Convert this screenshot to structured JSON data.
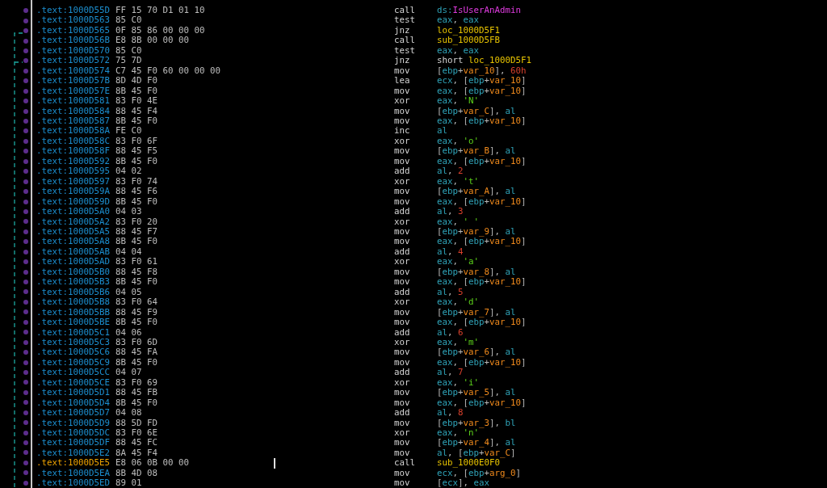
{
  "listing": {
    "rows": [
      {
        "address": ".text:1000D55D",
        "bytes": "FF 15 70 D1 01 10",
        "mnemonic": "call",
        "operands": [
          {
            "kind": "reg",
            "text": "ds:"
          },
          {
            "kind": "import",
            "text": "IsUserAnAdmin"
          }
        ],
        "current": false
      },
      {
        "address": ".text:1000D563",
        "bytes": "85 C0",
        "mnemonic": "test",
        "operands": [
          {
            "kind": "reg",
            "text": "eax"
          },
          {
            "kind": "p",
            "text": ", "
          },
          {
            "kind": "reg",
            "text": "eax"
          }
        ],
        "current": false
      },
      {
        "address": ".text:1000D565",
        "bytes": "0F 85 86 00 00 00",
        "mnemonic": "jnz",
        "operands": [
          {
            "kind": "name",
            "text": "loc_1000D5F1"
          }
        ],
        "current": false
      },
      {
        "address": ".text:1000D56B",
        "bytes": "E8 8B 00 00 00",
        "mnemonic": "call",
        "operands": [
          {
            "kind": "name",
            "text": "sub_1000D5FB"
          }
        ],
        "current": false
      },
      {
        "address": ".text:1000D570",
        "bytes": "85 C0",
        "mnemonic": "test",
        "operands": [
          {
            "kind": "reg",
            "text": "eax"
          },
          {
            "kind": "p",
            "text": ", "
          },
          {
            "kind": "reg",
            "text": "eax"
          }
        ],
        "current": false
      },
      {
        "address": ".text:1000D572",
        "bytes": "75 7D",
        "mnemonic": "jnz",
        "operands": [
          {
            "kind": "kw",
            "text": "short "
          },
          {
            "kind": "name",
            "text": "loc_1000D5F1"
          }
        ],
        "current": false
      },
      {
        "address": ".text:1000D574",
        "bytes": "C7 45 F0 60 00 00 00",
        "mnemonic": "mov",
        "operands": [
          {
            "kind": "p",
            "text": "["
          },
          {
            "kind": "reg",
            "text": "ebp"
          },
          {
            "kind": "p",
            "text": "+"
          },
          {
            "kind": "var",
            "text": "var_10"
          },
          {
            "kind": "p",
            "text": "], "
          },
          {
            "kind": "num",
            "text": "60h"
          }
        ],
        "current": false
      },
      {
        "address": ".text:1000D57B",
        "bytes": "8D 4D F0",
        "mnemonic": "lea",
        "operands": [
          {
            "kind": "reg",
            "text": "ecx"
          },
          {
            "kind": "p",
            "text": ", ["
          },
          {
            "kind": "reg",
            "text": "ebp"
          },
          {
            "kind": "p",
            "text": "+"
          },
          {
            "kind": "var",
            "text": "var_10"
          },
          {
            "kind": "p",
            "text": "]"
          }
        ],
        "current": false
      },
      {
        "address": ".text:1000D57E",
        "bytes": "8B 45 F0",
        "mnemonic": "mov",
        "operands": [
          {
            "kind": "reg",
            "text": "eax"
          },
          {
            "kind": "p",
            "text": ", ["
          },
          {
            "kind": "reg",
            "text": "ebp"
          },
          {
            "kind": "p",
            "text": "+"
          },
          {
            "kind": "var",
            "text": "var_10"
          },
          {
            "kind": "p",
            "text": "]"
          }
        ],
        "current": false
      },
      {
        "address": ".text:1000D581",
        "bytes": "83 F0 4E",
        "mnemonic": "xor",
        "operands": [
          {
            "kind": "reg",
            "text": "eax"
          },
          {
            "kind": "p",
            "text": ", "
          },
          {
            "kind": "str",
            "text": "'N'"
          }
        ],
        "current": false
      },
      {
        "address": ".text:1000D584",
        "bytes": "88 45 F4",
        "mnemonic": "mov",
        "operands": [
          {
            "kind": "p",
            "text": "["
          },
          {
            "kind": "reg",
            "text": "ebp"
          },
          {
            "kind": "p",
            "text": "+"
          },
          {
            "kind": "var",
            "text": "var_C"
          },
          {
            "kind": "p",
            "text": "], "
          },
          {
            "kind": "reg",
            "text": "al"
          }
        ],
        "current": false
      },
      {
        "address": ".text:1000D587",
        "bytes": "8B 45 F0",
        "mnemonic": "mov",
        "operands": [
          {
            "kind": "reg",
            "text": "eax"
          },
          {
            "kind": "p",
            "text": ", ["
          },
          {
            "kind": "reg",
            "text": "ebp"
          },
          {
            "kind": "p",
            "text": "+"
          },
          {
            "kind": "var",
            "text": "var_10"
          },
          {
            "kind": "p",
            "text": "]"
          }
        ],
        "current": false
      },
      {
        "address": ".text:1000D58A",
        "bytes": "FE C0",
        "mnemonic": "inc",
        "operands": [
          {
            "kind": "reg",
            "text": "al"
          }
        ],
        "current": false
      },
      {
        "address": ".text:1000D58C",
        "bytes": "83 F0 6F",
        "mnemonic": "xor",
        "operands": [
          {
            "kind": "reg",
            "text": "eax"
          },
          {
            "kind": "p",
            "text": ", "
          },
          {
            "kind": "str",
            "text": "'o'"
          }
        ],
        "current": false
      },
      {
        "address": ".text:1000D58F",
        "bytes": "88 45 F5",
        "mnemonic": "mov",
        "operands": [
          {
            "kind": "p",
            "text": "["
          },
          {
            "kind": "reg",
            "text": "ebp"
          },
          {
            "kind": "p",
            "text": "+"
          },
          {
            "kind": "var",
            "text": "var_B"
          },
          {
            "kind": "p",
            "text": "], "
          },
          {
            "kind": "reg",
            "text": "al"
          }
        ],
        "current": false
      },
      {
        "address": ".text:1000D592",
        "bytes": "8B 45 F0",
        "mnemonic": "mov",
        "operands": [
          {
            "kind": "reg",
            "text": "eax"
          },
          {
            "kind": "p",
            "text": ", ["
          },
          {
            "kind": "reg",
            "text": "ebp"
          },
          {
            "kind": "p",
            "text": "+"
          },
          {
            "kind": "var",
            "text": "var_10"
          },
          {
            "kind": "p",
            "text": "]"
          }
        ],
        "current": false
      },
      {
        "address": ".text:1000D595",
        "bytes": "04 02",
        "mnemonic": "add",
        "operands": [
          {
            "kind": "reg",
            "text": "al"
          },
          {
            "kind": "p",
            "text": ", "
          },
          {
            "kind": "num",
            "text": "2"
          }
        ],
        "current": false
      },
      {
        "address": ".text:1000D597",
        "bytes": "83 F0 74",
        "mnemonic": "xor",
        "operands": [
          {
            "kind": "reg",
            "text": "eax"
          },
          {
            "kind": "p",
            "text": ", "
          },
          {
            "kind": "str",
            "text": "'t'"
          }
        ],
        "current": false
      },
      {
        "address": ".text:1000D59A",
        "bytes": "88 45 F6",
        "mnemonic": "mov",
        "operands": [
          {
            "kind": "p",
            "text": "["
          },
          {
            "kind": "reg",
            "text": "ebp"
          },
          {
            "kind": "p",
            "text": "+"
          },
          {
            "kind": "var",
            "text": "var_A"
          },
          {
            "kind": "p",
            "text": "], "
          },
          {
            "kind": "reg",
            "text": "al"
          }
        ],
        "current": false
      },
      {
        "address": ".text:1000D59D",
        "bytes": "8B 45 F0",
        "mnemonic": "mov",
        "operands": [
          {
            "kind": "reg",
            "text": "eax"
          },
          {
            "kind": "p",
            "text": ", ["
          },
          {
            "kind": "reg",
            "text": "ebp"
          },
          {
            "kind": "p",
            "text": "+"
          },
          {
            "kind": "var",
            "text": "var_10"
          },
          {
            "kind": "p",
            "text": "]"
          }
        ],
        "current": false
      },
      {
        "address": ".text:1000D5A0",
        "bytes": "04 03",
        "mnemonic": "add",
        "operands": [
          {
            "kind": "reg",
            "text": "al"
          },
          {
            "kind": "p",
            "text": ", "
          },
          {
            "kind": "num",
            "text": "3"
          }
        ],
        "current": false
      },
      {
        "address": ".text:1000D5A2",
        "bytes": "83 F0 20",
        "mnemonic": "xor",
        "operands": [
          {
            "kind": "reg",
            "text": "eax"
          },
          {
            "kind": "p",
            "text": ", "
          },
          {
            "kind": "str",
            "text": "' '"
          }
        ],
        "current": false
      },
      {
        "address": ".text:1000D5A5",
        "bytes": "88 45 F7",
        "mnemonic": "mov",
        "operands": [
          {
            "kind": "p",
            "text": "["
          },
          {
            "kind": "reg",
            "text": "ebp"
          },
          {
            "kind": "p",
            "text": "+"
          },
          {
            "kind": "var",
            "text": "var_9"
          },
          {
            "kind": "p",
            "text": "], "
          },
          {
            "kind": "reg",
            "text": "al"
          }
        ],
        "current": false
      },
      {
        "address": ".text:1000D5A8",
        "bytes": "8B 45 F0",
        "mnemonic": "mov",
        "operands": [
          {
            "kind": "reg",
            "text": "eax"
          },
          {
            "kind": "p",
            "text": ", ["
          },
          {
            "kind": "reg",
            "text": "ebp"
          },
          {
            "kind": "p",
            "text": "+"
          },
          {
            "kind": "var",
            "text": "var_10"
          },
          {
            "kind": "p",
            "text": "]"
          }
        ],
        "current": false
      },
      {
        "address": ".text:1000D5AB",
        "bytes": "04 04",
        "mnemonic": "add",
        "operands": [
          {
            "kind": "reg",
            "text": "al"
          },
          {
            "kind": "p",
            "text": ", "
          },
          {
            "kind": "num",
            "text": "4"
          }
        ],
        "current": false
      },
      {
        "address": ".text:1000D5AD",
        "bytes": "83 F0 61",
        "mnemonic": "xor",
        "operands": [
          {
            "kind": "reg",
            "text": "eax"
          },
          {
            "kind": "p",
            "text": ", "
          },
          {
            "kind": "str",
            "text": "'a'"
          }
        ],
        "current": false
      },
      {
        "address": ".text:1000D5B0",
        "bytes": "88 45 F8",
        "mnemonic": "mov",
        "operands": [
          {
            "kind": "p",
            "text": "["
          },
          {
            "kind": "reg",
            "text": "ebp"
          },
          {
            "kind": "p",
            "text": "+"
          },
          {
            "kind": "var",
            "text": "var_8"
          },
          {
            "kind": "p",
            "text": "], "
          },
          {
            "kind": "reg",
            "text": "al"
          }
        ],
        "current": false
      },
      {
        "address": ".text:1000D5B3",
        "bytes": "8B 45 F0",
        "mnemonic": "mov",
        "operands": [
          {
            "kind": "reg",
            "text": "eax"
          },
          {
            "kind": "p",
            "text": ", ["
          },
          {
            "kind": "reg",
            "text": "ebp"
          },
          {
            "kind": "p",
            "text": "+"
          },
          {
            "kind": "var",
            "text": "var_10"
          },
          {
            "kind": "p",
            "text": "]"
          }
        ],
        "current": false
      },
      {
        "address": ".text:1000D5B6",
        "bytes": "04 05",
        "mnemonic": "add",
        "operands": [
          {
            "kind": "reg",
            "text": "al"
          },
          {
            "kind": "p",
            "text": ", "
          },
          {
            "kind": "num",
            "text": "5"
          }
        ],
        "current": false
      },
      {
        "address": ".text:1000D5B8",
        "bytes": "83 F0 64",
        "mnemonic": "xor",
        "operands": [
          {
            "kind": "reg",
            "text": "eax"
          },
          {
            "kind": "p",
            "text": ", "
          },
          {
            "kind": "str",
            "text": "'d'"
          }
        ],
        "current": false
      },
      {
        "address": ".text:1000D5BB",
        "bytes": "88 45 F9",
        "mnemonic": "mov",
        "operands": [
          {
            "kind": "p",
            "text": "["
          },
          {
            "kind": "reg",
            "text": "ebp"
          },
          {
            "kind": "p",
            "text": "+"
          },
          {
            "kind": "var",
            "text": "var_7"
          },
          {
            "kind": "p",
            "text": "], "
          },
          {
            "kind": "reg",
            "text": "al"
          }
        ],
        "current": false
      },
      {
        "address": ".text:1000D5BE",
        "bytes": "8B 45 F0",
        "mnemonic": "mov",
        "operands": [
          {
            "kind": "reg",
            "text": "eax"
          },
          {
            "kind": "p",
            "text": ", ["
          },
          {
            "kind": "reg",
            "text": "ebp"
          },
          {
            "kind": "p",
            "text": "+"
          },
          {
            "kind": "var",
            "text": "var_10"
          },
          {
            "kind": "p",
            "text": "]"
          }
        ],
        "current": false
      },
      {
        "address": ".text:1000D5C1",
        "bytes": "04 06",
        "mnemonic": "add",
        "operands": [
          {
            "kind": "reg",
            "text": "al"
          },
          {
            "kind": "p",
            "text": ", "
          },
          {
            "kind": "num",
            "text": "6"
          }
        ],
        "current": false
      },
      {
        "address": ".text:1000D5C3",
        "bytes": "83 F0 6D",
        "mnemonic": "xor",
        "operands": [
          {
            "kind": "reg",
            "text": "eax"
          },
          {
            "kind": "p",
            "text": ", "
          },
          {
            "kind": "str",
            "text": "'m'"
          }
        ],
        "current": false
      },
      {
        "address": ".text:1000D5C6",
        "bytes": "88 45 FA",
        "mnemonic": "mov",
        "operands": [
          {
            "kind": "p",
            "text": "["
          },
          {
            "kind": "reg",
            "text": "ebp"
          },
          {
            "kind": "p",
            "text": "+"
          },
          {
            "kind": "var",
            "text": "var_6"
          },
          {
            "kind": "p",
            "text": "], "
          },
          {
            "kind": "reg",
            "text": "al"
          }
        ],
        "current": false
      },
      {
        "address": ".text:1000D5C9",
        "bytes": "8B 45 F0",
        "mnemonic": "mov",
        "operands": [
          {
            "kind": "reg",
            "text": "eax"
          },
          {
            "kind": "p",
            "text": ", ["
          },
          {
            "kind": "reg",
            "text": "ebp"
          },
          {
            "kind": "p",
            "text": "+"
          },
          {
            "kind": "var",
            "text": "var_10"
          },
          {
            "kind": "p",
            "text": "]"
          }
        ],
        "current": false
      },
      {
        "address": ".text:1000D5CC",
        "bytes": "04 07",
        "mnemonic": "add",
        "operands": [
          {
            "kind": "reg",
            "text": "al"
          },
          {
            "kind": "p",
            "text": ", "
          },
          {
            "kind": "num",
            "text": "7"
          }
        ],
        "current": false
      },
      {
        "address": ".text:1000D5CE",
        "bytes": "83 F0 69",
        "mnemonic": "xor",
        "operands": [
          {
            "kind": "reg",
            "text": "eax"
          },
          {
            "kind": "p",
            "text": ", "
          },
          {
            "kind": "str",
            "text": "'i'"
          }
        ],
        "current": false
      },
      {
        "address": ".text:1000D5D1",
        "bytes": "88 45 FB",
        "mnemonic": "mov",
        "operands": [
          {
            "kind": "p",
            "text": "["
          },
          {
            "kind": "reg",
            "text": "ebp"
          },
          {
            "kind": "p",
            "text": "+"
          },
          {
            "kind": "var",
            "text": "var_5"
          },
          {
            "kind": "p",
            "text": "], "
          },
          {
            "kind": "reg",
            "text": "al"
          }
        ],
        "current": false
      },
      {
        "address": ".text:1000D5D4",
        "bytes": "8B 45 F0",
        "mnemonic": "mov",
        "operands": [
          {
            "kind": "reg",
            "text": "eax"
          },
          {
            "kind": "p",
            "text": ", ["
          },
          {
            "kind": "reg",
            "text": "ebp"
          },
          {
            "kind": "p",
            "text": "+"
          },
          {
            "kind": "var",
            "text": "var_10"
          },
          {
            "kind": "p",
            "text": "]"
          }
        ],
        "current": false
      },
      {
        "address": ".text:1000D5D7",
        "bytes": "04 08",
        "mnemonic": "add",
        "operands": [
          {
            "kind": "reg",
            "text": "al"
          },
          {
            "kind": "p",
            "text": ", "
          },
          {
            "kind": "num",
            "text": "8"
          }
        ],
        "current": false
      },
      {
        "address": ".text:1000D5D9",
        "bytes": "88 5D FD",
        "mnemonic": "mov",
        "operands": [
          {
            "kind": "p",
            "text": "["
          },
          {
            "kind": "reg",
            "text": "ebp"
          },
          {
            "kind": "p",
            "text": "+"
          },
          {
            "kind": "var",
            "text": "var_3"
          },
          {
            "kind": "p",
            "text": "], "
          },
          {
            "kind": "reg",
            "text": "bl"
          }
        ],
        "current": false
      },
      {
        "address": ".text:1000D5DC",
        "bytes": "83 F0 6E",
        "mnemonic": "xor",
        "operands": [
          {
            "kind": "reg",
            "text": "eax"
          },
          {
            "kind": "p",
            "text": ", "
          },
          {
            "kind": "str",
            "text": "'n'"
          }
        ],
        "current": false
      },
      {
        "address": ".text:1000D5DF",
        "bytes": "88 45 FC",
        "mnemonic": "mov",
        "operands": [
          {
            "kind": "p",
            "text": "["
          },
          {
            "kind": "reg",
            "text": "ebp"
          },
          {
            "kind": "p",
            "text": "+"
          },
          {
            "kind": "var",
            "text": "var_4"
          },
          {
            "kind": "p",
            "text": "], "
          },
          {
            "kind": "reg",
            "text": "al"
          }
        ],
        "current": false
      },
      {
        "address": ".text:1000D5E2",
        "bytes": "8A 45 F4",
        "mnemonic": "mov",
        "operands": [
          {
            "kind": "reg",
            "text": "al"
          },
          {
            "kind": "p",
            "text": ", ["
          },
          {
            "kind": "reg",
            "text": "ebp"
          },
          {
            "kind": "p",
            "text": "+"
          },
          {
            "kind": "var",
            "text": "var_C"
          },
          {
            "kind": "p",
            "text": "]"
          }
        ],
        "current": false
      },
      {
        "address": ".text:1000D5E5",
        "bytes": "E8 06 0B 00 00",
        "mnemonic": "call",
        "operands": [
          {
            "kind": "name",
            "text": "sub_1000E0F0"
          }
        ],
        "current": true
      },
      {
        "address": ".text:1000D5EA",
        "bytes": "8B 4D 08",
        "mnemonic": "mov",
        "operands": [
          {
            "kind": "reg",
            "text": "ecx"
          },
          {
            "kind": "p",
            "text": ", ["
          },
          {
            "kind": "reg",
            "text": "ebp"
          },
          {
            "kind": "p",
            "text": "+"
          },
          {
            "kind": "var",
            "text": "arg_0"
          },
          {
            "kind": "p",
            "text": "]"
          }
        ],
        "current": false
      },
      {
        "address": ".text:1000D5ED",
        "bytes": "89 01",
        "mnemonic": "mov",
        "operands": [
          {
            "kind": "p",
            "text": "["
          },
          {
            "kind": "reg",
            "text": "ecx"
          },
          {
            "kind": "p",
            "text": "], "
          },
          {
            "kind": "reg",
            "text": "eax"
          }
        ],
        "current": false
      }
    ]
  }
}
